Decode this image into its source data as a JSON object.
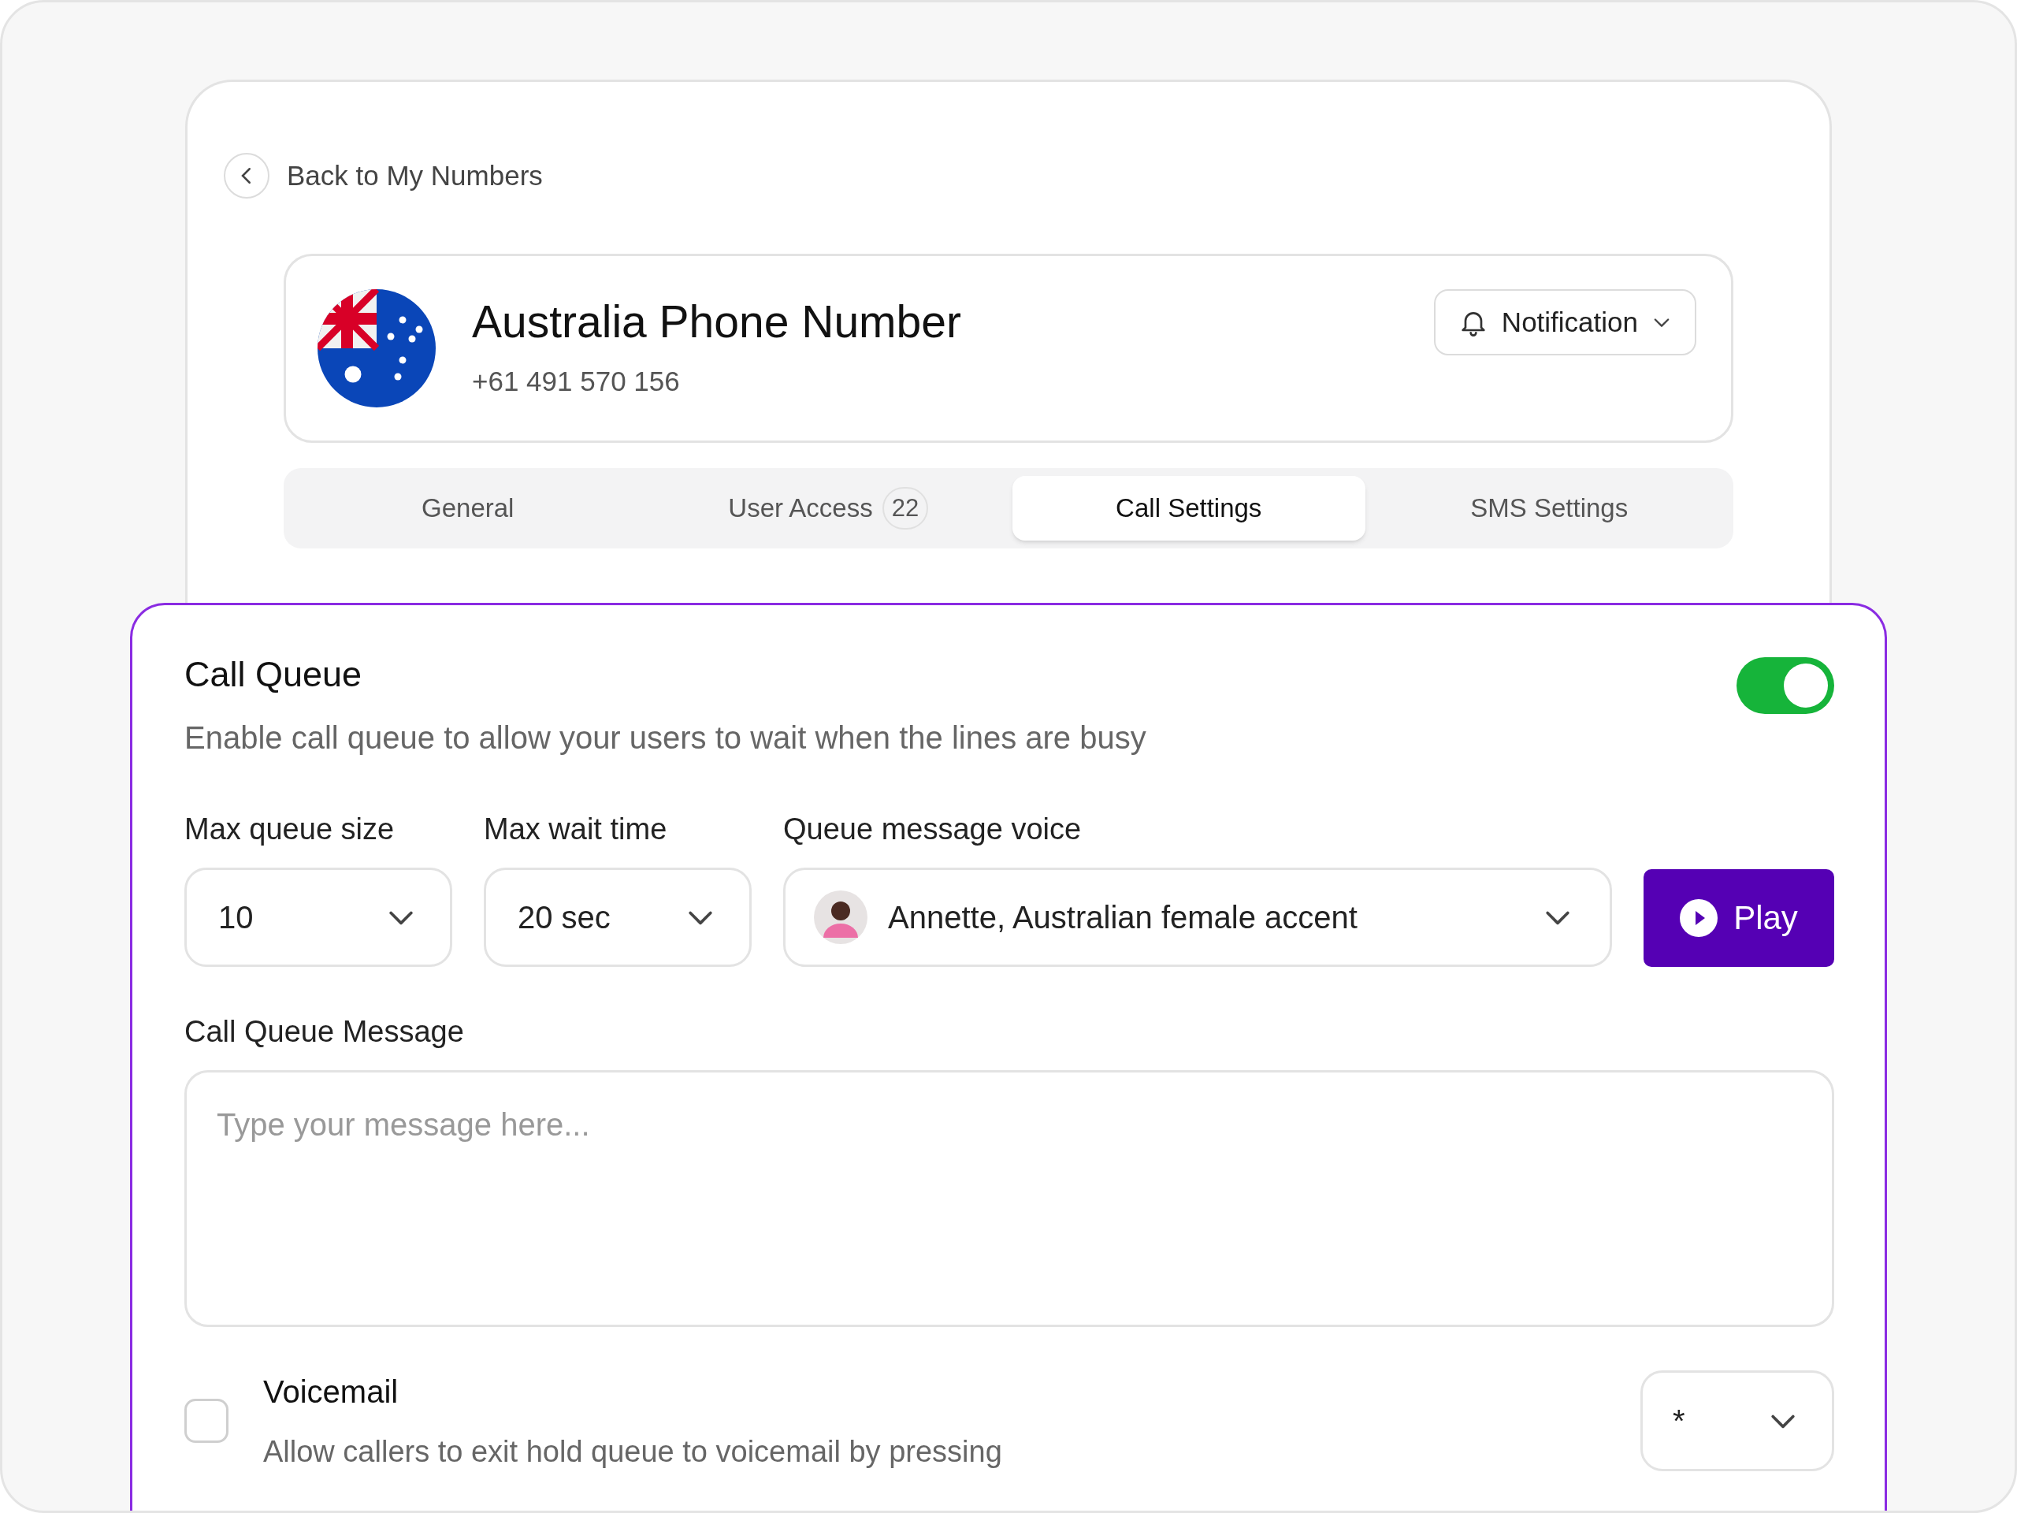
{
  "back_link": {
    "label": "Back to My Numbers"
  },
  "number": {
    "title": "Australia Phone Number",
    "phone": "+61 491 570 156",
    "notification_button": "Notification"
  },
  "tabs": [
    {
      "label": "General",
      "selected": false
    },
    {
      "label": "User Access",
      "badge": "22",
      "selected": false
    },
    {
      "label": "Call Settings",
      "selected": true
    },
    {
      "label": "SMS Settings",
      "selected": false
    }
  ],
  "call_queue": {
    "title": "Call Queue",
    "description": "Enable call queue to allow your users to wait when the lines are busy",
    "on": true,
    "fields": [
      {
        "kind": "select",
        "label": "Max queue size",
        "value": "10"
      },
      {
        "kind": "select",
        "label": "Max wait time",
        "value": "20 sec"
      },
      {
        "kind": "voice",
        "label": "Queue message voice",
        "value": "Annette, Australian female accent"
      }
    ],
    "play_button": "Play",
    "message": {
      "label": "Call Queue Message",
      "placeholder": "Type your message here..."
    },
    "options": [
      {
        "title": "Voicemail",
        "description": "Allow callers to exit hold queue to voicemail by pressing",
        "checked": false,
        "key": "*"
      }
    ]
  }
}
